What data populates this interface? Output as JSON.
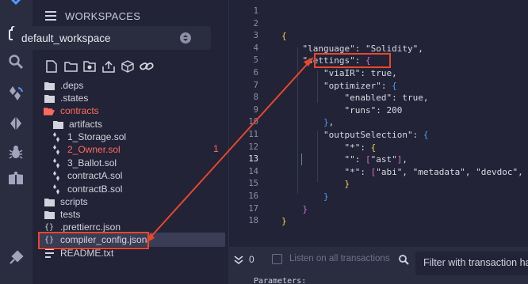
{
  "sidebar": {
    "header_title": "WORKSPACES",
    "workspace_selected": "default_workspace",
    "rail_icons": [
      "remix-logo-icon",
      "file-explorer-icon",
      "search-icon",
      "solidity-compiler-icon",
      "deploy-icon",
      "debugger-icon",
      "learneth-icon",
      "plugin-manager-icon"
    ],
    "toolbar_icons": [
      "new-file-icon",
      "new-folder-icon",
      "github-icon",
      "upload-icon",
      "package-icon",
      "link-icon"
    ]
  },
  "tree": [
    {
      "name": ".deps",
      "type": "folder",
      "depth": 0
    },
    {
      "name": ".states",
      "type": "folder",
      "depth": 0
    },
    {
      "name": "contracts",
      "type": "folder-open",
      "depth": 0,
      "highlight": true
    },
    {
      "name": "artifacts",
      "type": "folder",
      "depth": 1
    },
    {
      "name": "1_Storage.sol",
      "type": "sol",
      "depth": 1
    },
    {
      "name": "2_Owner.sol",
      "type": "sol",
      "depth": 1,
      "highlight": true,
      "badge": "1"
    },
    {
      "name": "3_Ballot.sol",
      "type": "sol",
      "depth": 1
    },
    {
      "name": "contractA.sol",
      "type": "sol",
      "depth": 1
    },
    {
      "name": "contractB.sol",
      "type": "sol",
      "depth": 1
    },
    {
      "name": "scripts",
      "type": "folder",
      "depth": 0
    },
    {
      "name": "tests",
      "type": "folder",
      "depth": 0
    },
    {
      "name": ".prettierrc.json",
      "type": "json",
      "depth": 0
    },
    {
      "name": "compiler_config.json",
      "type": "json",
      "depth": 0,
      "selected": true
    },
    {
      "name": "README.txt",
      "type": "txt",
      "depth": 0
    }
  ],
  "editor": {
    "current_line": 13,
    "lines": [
      {
        "n": 1,
        "code": ""
      },
      {
        "n": 2,
        "code": ""
      },
      {
        "n": 3,
        "code": "{"
      },
      {
        "n": 4,
        "code": "    \"language\": \"Solidity\","
      },
      {
        "n": 5,
        "code": "    \"settings\": {"
      },
      {
        "n": 6,
        "code": "        \"viaIR\": true,"
      },
      {
        "n": 7,
        "code": "        \"optimizer\": {"
      },
      {
        "n": 8,
        "code": "            \"enabled\": true,"
      },
      {
        "n": 9,
        "code": "            \"runs\": 200"
      },
      {
        "n": 10,
        "code": "        },"
      },
      {
        "n": 11,
        "code": "        \"outputSelection\": {"
      },
      {
        "n": 12,
        "code": "            \"*\": {"
      },
      {
        "n": 13,
        "code": "            \"\": [\"ast\"],"
      },
      {
        "n": 14,
        "code": "            \"*\": [\"abi\", \"metadata\", \"devdoc\", \"u"
      },
      {
        "n": 15,
        "code": "            }"
      },
      {
        "n": 16,
        "code": "        }"
      },
      {
        "n": 17,
        "code": "    }"
      },
      {
        "n": 18,
        "code": "}"
      }
    ]
  },
  "terminal": {
    "count": "0",
    "listen_label": "Listen on all transactions",
    "filter_placeholder": "Filter with transaction hash",
    "output_text": "Parameters:"
  },
  "colors": {
    "annotation": "#e8472c",
    "error_text": "#ff6b5b",
    "bracket_level1": "#f2d74b",
    "bracket_level2": "#d96ad7",
    "bracket_level3": "#4c9cff"
  }
}
